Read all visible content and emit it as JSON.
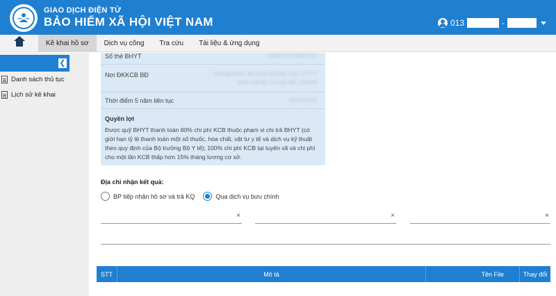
{
  "header": {
    "brand_top": "GIAO DỊCH ĐIỆN TỬ",
    "brand_main": "BẢO HIỂM XÃ HỘI VIỆT NAM",
    "user_prefix": "013",
    "user_sep": "-"
  },
  "nav": {
    "items": [
      {
        "label": "Kê khai hồ sơ",
        "active": true
      },
      {
        "label": "Dịch vụ công",
        "active": false
      },
      {
        "label": "Tra cứu",
        "active": false
      },
      {
        "label": "Tài liệu & ứng dụng",
        "active": false
      }
    ]
  },
  "sidebar": {
    "items": [
      {
        "label": "Danh sách thủ tục"
      },
      {
        "label": "Lịch sử kê khai"
      }
    ]
  },
  "card": {
    "rows": [
      {
        "label": "Số thẻ BHYT",
        "value": "DN4010314667555"
      },
      {
        "label": "Nơi ĐKKCB BĐ",
        "value": "Phòng khám đa khoa 103 Bà Triệu (TTYT quận Hai Bà Trưng) (BV. 01004)"
      },
      {
        "label": "Thời điểm 5 năm liên tục",
        "value": "01/07/2024"
      }
    ],
    "quyen_loi_title": "Quyền lợi",
    "quyen_loi_text": "Được quỹ BHYT thanh toán 80% chi phí KCB thuộc phạm vi chi trả BHYT (có giới hạn tỷ lệ thanh toán một số thuốc, hóa chất, vật tư y tế và dịch vụ kỹ thuật theo quy định của Bộ trưởng Bộ Y tế); 100% chi phí KCB tại tuyến xã và chi phí cho một lần KCB thấp hơn 15% tháng lương cơ sở."
  },
  "address": {
    "label": "Địa chỉ nhận kết quả:",
    "options": [
      {
        "label": "BP tiếp nhận hồ sơ và trả KQ",
        "checked": false
      },
      {
        "label": "Qua dịch vụ bưu chính",
        "checked": true
      }
    ],
    "clear_glyph": "×"
  },
  "table": {
    "columns": [
      "STT",
      "Mô tả",
      "Tên File",
      "Thay đổi"
    ]
  },
  "colors": {
    "primary": "#1f7fd0",
    "card_bg": "#dbe9f6",
    "nav_bg": "#f2f2f2",
    "sidebar_bg": "#eeeeee"
  }
}
